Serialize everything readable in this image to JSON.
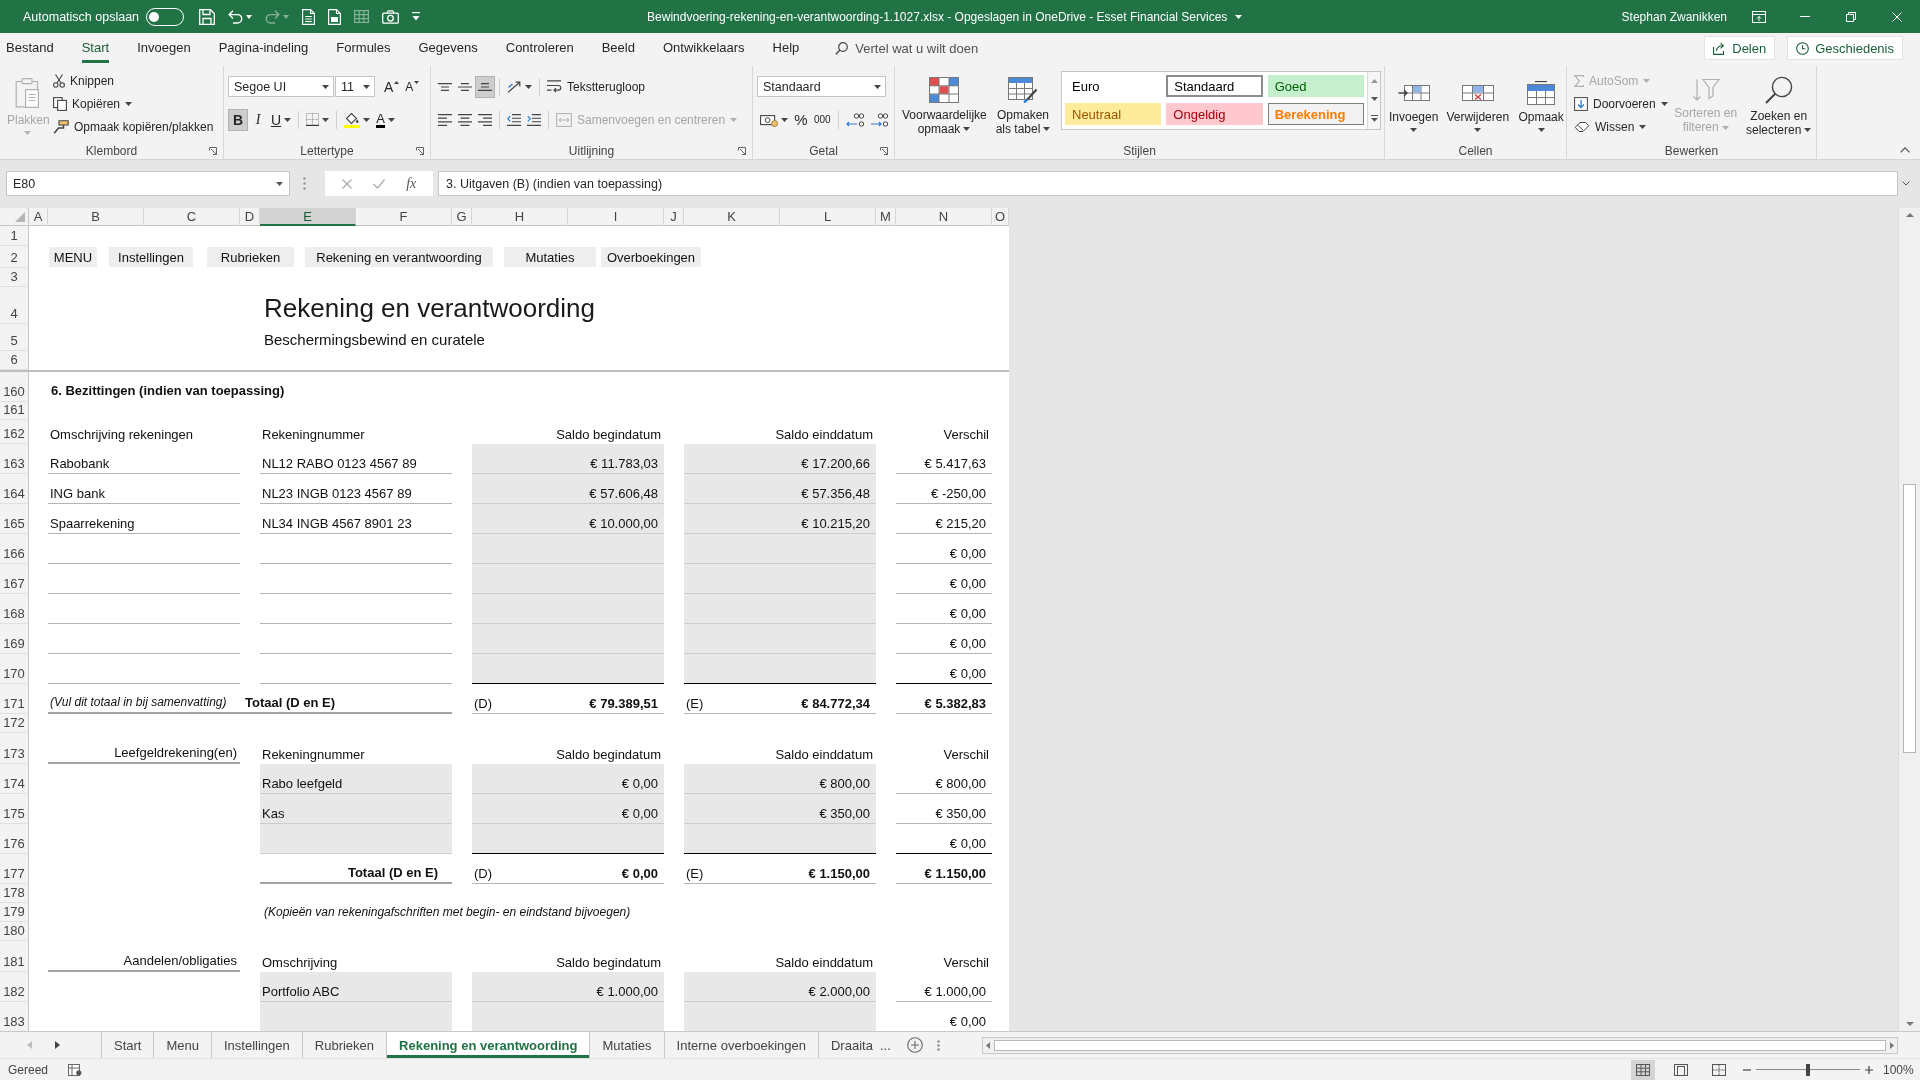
{
  "title_bar": {
    "autosave": {
      "label": "Automatisch opslaan",
      "on": false
    },
    "quick_access": [
      {
        "disabled": false
      },
      {
        "disabled": false
      },
      {
        "disabled": true
      },
      {
        "disabled": false
      },
      {
        "disabled": false
      },
      {
        "disabled": true
      },
      {
        "disabled": false
      },
      {
        "disabled": false
      }
    ],
    "title": "Bewindvoering-rekening-en-verantwoording-1.1027.xlsx - Opgeslagen in OneDrive - Esset Financial Services",
    "user": "Stephan Zwanikken"
  },
  "ribbon": {
    "tabs": [
      {
        "label": "Bestand",
        "selected": false
      },
      {
        "label": "Start",
        "selected": true
      },
      {
        "label": "Invoegen",
        "selected": false
      },
      {
        "label": "Pagina-indeling",
        "selected": false
      },
      {
        "label": "Formules",
        "selected": false
      },
      {
        "label": "Gegevens",
        "selected": false
      },
      {
        "label": "Controleren",
        "selected": false
      },
      {
        "label": "Beeld",
        "selected": false
      },
      {
        "label": "Ontwikkelaars",
        "selected": false
      },
      {
        "label": "Help",
        "selected": false
      }
    ],
    "tell_me": {
      "placeholder": "Vertel wat u wilt doen"
    },
    "share": "Delen",
    "history": "Geschiedenis",
    "clipboard": {
      "label": "Klembord",
      "paste": {
        "label": "Plakken",
        "disabled": true
      },
      "commands": [
        "Knippen",
        "Kopiëren",
        "Opmaak kopiëren/plakken"
      ]
    },
    "font": {
      "label": "Lettertype",
      "font_name": "Segoe UI",
      "font_size": "11",
      "size_buttons": [
        "A",
        "A"
      ],
      "styles": [
        {
          "label": "B",
          "pressed": true
        },
        {
          "label": "I",
          "pressed": false
        },
        {
          "label": "U",
          "pressed": false
        }
      ],
      "font_color": "A"
    },
    "alignment": {
      "label": "Uitlijning",
      "align_buttons": [
        {
          "pressed": false
        },
        {
          "pressed": false
        },
        {
          "pressed": true
        },
        {
          "pressed": false
        },
        {
          "pressed": false
        },
        {
          "pressed": false
        }
      ],
      "wrap_text": "Tekstterugloop",
      "merge": {
        "label": "Samenvoegen en centreren",
        "disabled": true
      }
    },
    "number": {
      "label": "Getal",
      "format": "Standaard",
      "percent": "%",
      "thousands": "000"
    },
    "styles": {
      "label": "Stijlen",
      "conditional_formatting": "Voorwaardelijke opmaak",
      "format_as_table": "Opmaken als tabel",
      "gallery": [
        {
          "label": "Euro",
          "kind": "plain",
          "selected": false
        },
        {
          "label": "Standaard",
          "kind": "plain",
          "selected": true
        },
        {
          "label": "Goed",
          "kind": "good",
          "selected": false
        },
        {
          "label": "Neutraal",
          "kind": "neutral",
          "selected": false
        },
        {
          "label": "Ongeldig",
          "kind": "bad",
          "selected": false
        },
        {
          "label": "Berekening",
          "kind": "calculation",
          "selected": false
        }
      ]
    },
    "cells": {
      "label": "Cellen",
      "commands": [
        "Invoegen",
        "Verwijderen",
        "Opmaak"
      ]
    },
    "editing": {
      "label": "Bewerken",
      "commands": [
        {
          "label": "AutoSom",
          "disabled": true
        },
        {
          "label": "Doorvoeren",
          "disabled": false
        },
        {
          "label": "Wissen",
          "disabled": false
        }
      ],
      "sort_filter": {
        "label": "Sorteren en filteren",
        "disabled": true
      },
      "find_select": {
        "label": "Zoeken en selecteren",
        "disabled": false
      }
    }
  },
  "formula_bar": {
    "name_box": "E80",
    "function_button": "fx",
    "formula": "3. Uitgaven (B) (indien van toepassing)"
  },
  "sheet": {
    "columns": [
      {
        "label": "A",
        "selected": false
      },
      {
        "label": "B",
        "selected": false
      },
      {
        "label": "C",
        "selected": false
      },
      {
        "label": "D",
        "selected": false
      },
      {
        "label": "E",
        "selected": true
      },
      {
        "label": "F",
        "selected": false
      },
      {
        "label": "G",
        "selected": false
      },
      {
        "label": "H",
        "selected": false
      },
      {
        "label": "I",
        "selected": false
      },
      {
        "label": "J",
        "selected": false
      },
      {
        "label": "K",
        "selected": false
      },
      {
        "label": "L",
        "selected": false
      },
      {
        "label": "M",
        "selected": false
      },
      {
        "label": "N",
        "selected": false
      },
      {
        "label": "O",
        "selected": false
      }
    ],
    "row_numbers": [
      "1",
      "2",
      "3",
      "4",
      "5",
      "6",
      "160",
      "161",
      "162",
      "163",
      "164",
      "165",
      "166",
      "167",
      "168",
      "169",
      "170",
      "171",
      "172",
      "173",
      "174",
      "175",
      "176",
      "177",
      "178",
      "179",
      "180",
      "181",
      "182",
      "183"
    ],
    "nav_buttons": [
      "MENU",
      "Instellingen",
      "Rubrieken",
      "Rekening en verantwoording",
      "Mutaties",
      "Overboekingen"
    ],
    "title": "Rekening en verantwoording",
    "subtitle": "Beschermingsbewind en curatele",
    "section_title": "6. Bezittingen (indien van toepassing)",
    "tables": [
      {
        "kind": "accounts",
        "headers": {
          "description": "Omschrijving rekeningen",
          "account": "Rekeningnummer",
          "opening": "Saldo begindatum",
          "closing": "Saldo einddatum",
          "difference": "Verschil"
        },
        "rows": [
          {
            "description": "Rabobank",
            "account": "NL12 RABO 0123 4567 89",
            "opening": "€ 11.783,03",
            "closing": "€ 17.200,66",
            "difference": "€ 5.417,63"
          },
          {
            "description": "ING bank",
            "account": "NL23 INGB 0123 4567 89",
            "opening": "€ 57.606,48",
            "closing": "€ 57.356,48",
            "difference": "€ -250,00"
          },
          {
            "description": "Spaarrekening",
            "account": "NL34 INGB 4567 8901 23",
            "opening": "€ 10.000,00",
            "closing": "€ 10.215,20",
            "difference": "€ 215,20"
          },
          {
            "difference": "€ 0,00"
          },
          {
            "difference": "€ 0,00"
          },
          {
            "difference": "€ 0,00"
          },
          {
            "difference": "€ 0,00"
          },
          {
            "difference": "€ 0,00"
          }
        ],
        "total": {
          "note": "(Vul dit totaal in bij samenvatting)",
          "label": "Totaal (D en E)",
          "opening_marker": "(D)",
          "opening": "€ 79.389,51",
          "closing_marker": "(E)",
          "closing": "€ 84.772,34",
          "difference": "€ 5.382,83"
        }
      },
      {
        "kind": "grouped",
        "title": "Leefgeldrekening(en)",
        "headers": {
          "account": "Rekeningnummer",
          "opening": "Saldo begindatum",
          "closing": "Saldo einddatum",
          "difference": "Verschil"
        },
        "rows": [
          {
            "account": "Rabo leefgeld",
            "opening": "€ 0,00",
            "closing": "€ 800,00",
            "difference": "€ 800,00"
          },
          {
            "account": "Kas",
            "opening": "€ 0,00",
            "closing": "€ 350,00",
            "difference": "€ 350,00"
          },
          {
            "difference": "€ 0,00"
          }
        ],
        "total": {
          "label": "Totaal (D en E)",
          "opening_marker": "(D)",
          "opening": "€ 0,00",
          "closing_marker": "(E)",
          "closing": "€ 1.150,00",
          "difference": "€ 1.150,00"
        },
        "footnote": "(Kopieën van rekeningafschriften met begin- en eindstand bijvoegen)"
      },
      {
        "kind": "grouped",
        "title": "Aandelen/obligaties",
        "headers": {
          "account": "Omschrijving",
          "opening": "Saldo begindatum",
          "closing": "Saldo einddatum",
          "difference": "Verschil"
        },
        "rows": [
          {
            "account": "Portfolio ABC",
            "opening": "€ 1.000,00",
            "closing": "€ 2.000,00",
            "difference": "€ 1.000,00"
          },
          {
            "difference": "€ 0,00"
          }
        ]
      }
    ]
  },
  "sheet_tabs": {
    "scroll_buttons": [
      {
        "disabled": true
      },
      {
        "disabled": false
      }
    ],
    "tabs": [
      {
        "label": "Start",
        "selected": false
      },
      {
        "label": "Menu",
        "selected": false
      },
      {
        "label": "Instellingen",
        "selected": false
      },
      {
        "label": "Rubrieken",
        "selected": false
      },
      {
        "label": "Rekening en verantwoording",
        "selected": true
      },
      {
        "label": "Mutaties",
        "selected": false
      },
      {
        "label": "Interne overboekingen",
        "selected": false
      },
      {
        "label": "Draaita",
        "selected": false
      }
    ],
    "more": "..."
  },
  "status_bar": {
    "status": "Gereed",
    "views": [
      {
        "selected": true
      },
      {
        "selected": false
      },
      {
        "selected": false
      }
    ],
    "zoom": {
      "level": 0.5,
      "reading": "100%"
    }
  }
}
